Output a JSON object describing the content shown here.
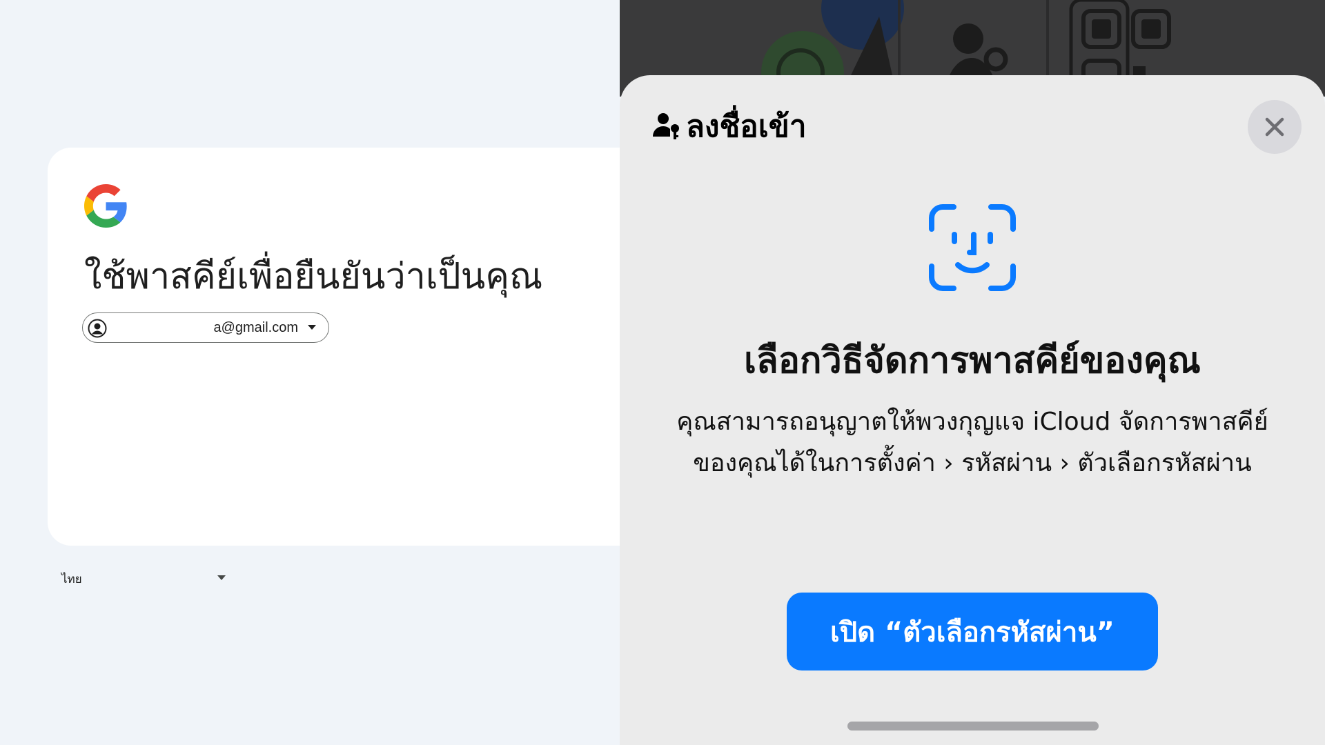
{
  "google": {
    "title": "ใช้พาสคีย์เพื่อยืนยันว่าเป็นคุณ",
    "account_email": "a@gmail.com",
    "language": "ไทย"
  },
  "sheet": {
    "header_title": "ลงชื่อเข้า",
    "heading": "เลือกวิธีจัดการพาสคีย์ของคุณ",
    "description_line1": "คุณสามารถอนุญาตให้พวงกุญแจ iCloud จัดการพาสคีย์",
    "description_line2": "ของคุณได้ในการตั้งค่า › รหัสผ่าน › ตัวเลือกรหัสผ่าน",
    "button_label": "เปิด “ตัวเลือกรหัสผ่าน”"
  },
  "colors": {
    "ios_blue": "#0a7aff",
    "google_blue": "#4285f4",
    "google_red": "#ea4335",
    "google_yellow": "#fbbc05",
    "google_green": "#34a853"
  },
  "icons": [
    "google-logo-icon",
    "account-circle-icon",
    "caret-down-icon",
    "person-key-icon",
    "close-icon",
    "face-id-icon"
  ]
}
